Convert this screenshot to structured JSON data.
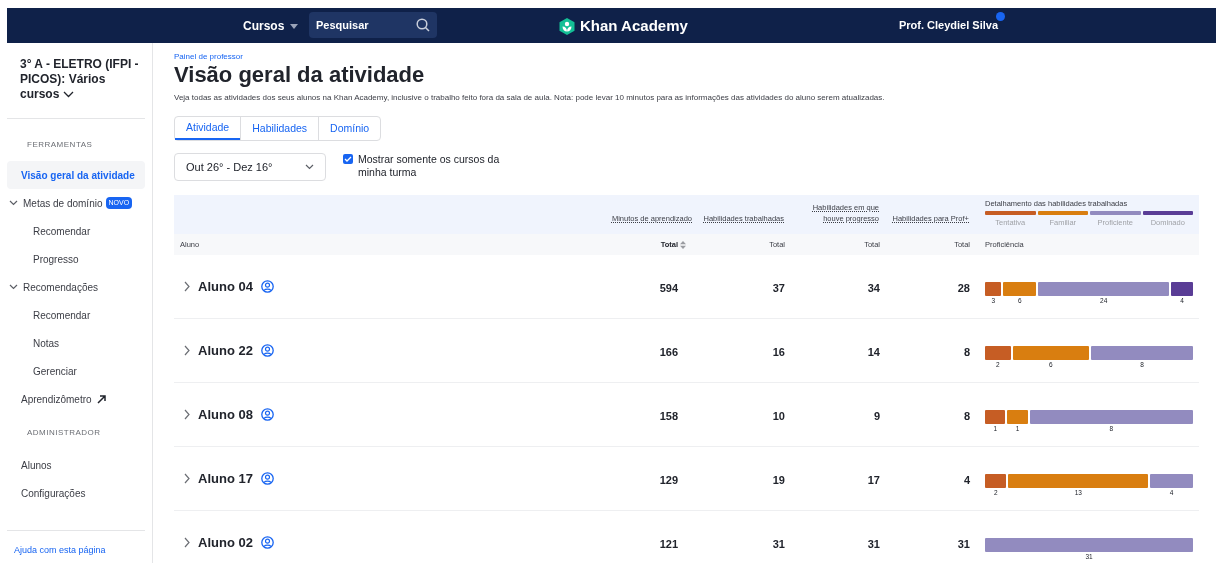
{
  "navbar": {
    "courses_menu": "Cursos",
    "search": {
      "placeholder": "Pesquisar"
    },
    "logo": "Khan Academy",
    "profile": {
      "name": "Prof. Cleydiel Silva",
      "notification": true
    }
  },
  "sidebar": {
    "class_title": "3° A - ELETRO (IFPI - PICOS): Vários cursos",
    "sections": [
      {
        "heading": "FERRAMENTAS",
        "items": [
          {
            "label": "Visão geral da atividade",
            "selected": true
          },
          {
            "label": "Metas de domínio",
            "badge": "NOVO",
            "expanded": true,
            "selected": false,
            "children": [
              {
                "label": "Recomendar",
                "selected": false
              },
              {
                "label": "Progresso",
                "selected": false
              }
            ]
          },
          {
            "label": "Recomendações",
            "expanded": true,
            "selected": false,
            "children": [
              {
                "label": "Recomendar",
                "selected": false
              },
              {
                "label": "Notas",
                "selected": false
              },
              {
                "label": "Gerenciar",
                "selected": false
              }
            ]
          },
          {
            "label": "Aprendizômetro",
            "external": true,
            "selected": false
          }
        ]
      },
      {
        "heading": "ADMINISTRADOR",
        "items": [
          {
            "label": "Alunos",
            "selected": false
          },
          {
            "label": "Configurações",
            "selected": false
          }
        ]
      }
    ],
    "help_link": "Ajuda com esta página"
  },
  "main": {
    "breadcrumb": "Painel de professor",
    "title": "Visão geral da atividade",
    "description": "Veja todas as atividades dos seus alunos na Khan Academy, inclusive o trabalho feito fora da sala de aula. Nota: pode levar 10 minutos para as informações das atividades do aluno serem atualizadas.",
    "tabs": [
      {
        "label": "Atividade",
        "selected": true
      },
      {
        "label": "Habilidades",
        "selected": false
      },
      {
        "label": "Domínio",
        "selected": false
      }
    ],
    "date_range": "Out 26° - Dez 16°",
    "filter_checkbox": {
      "label": "Mostrar somente os cursos da minha turma",
      "checked": true
    },
    "table": {
      "group_headers": [
        "Minutos de aprendizado",
        "Habilidades trabalhadas",
        "Habilidades em que houve progresso",
        "Habilidades para Prof+"
      ],
      "breakdown": {
        "title": "Detalhamento das habilidades trabalhadas",
        "legend": [
          {
            "kind": "tentativa",
            "label": "Tentativa"
          },
          {
            "kind": "familiar",
            "label": "Familiar"
          },
          {
            "kind": "proficiente",
            "label": "Proficiente"
          },
          {
            "kind": "dominado",
            "label": "Dominado"
          }
        ]
      },
      "columns": [
        "Aluno",
        "Total",
        "Total",
        "Total",
        "Total",
        "Proficiência"
      ],
      "rows": [
        {
          "student": "Aluno 04",
          "minutes": "594",
          "worked": "37",
          "progressed": "34",
          "prof_plus": "28",
          "segments": [
            {
              "kind": "tentativa",
              "count": "3"
            },
            {
              "kind": "familiar",
              "count": "6"
            },
            {
              "kind": "proficiente",
              "count": "24"
            },
            {
              "kind": "dominado",
              "count": "4"
            }
          ]
        },
        {
          "student": "Aluno 22",
          "minutes": "166",
          "worked": "16",
          "progressed": "14",
          "prof_plus": "8",
          "segments": [
            {
              "kind": "tentativa",
              "count": "2"
            },
            {
              "kind": "familiar",
              "count": "6"
            },
            {
              "kind": "proficiente",
              "count": "8"
            }
          ]
        },
        {
          "student": "Aluno 08",
          "minutes": "158",
          "worked": "10",
          "progressed": "9",
          "prof_plus": "8",
          "segments": [
            {
              "kind": "tentativa",
              "count": "1"
            },
            {
              "kind": "familiar",
              "count": "1"
            },
            {
              "kind": "proficiente",
              "count": "8"
            }
          ]
        },
        {
          "student": "Aluno 17",
          "minutes": "129",
          "worked": "19",
          "progressed": "17",
          "prof_plus": "4",
          "segments": [
            {
              "kind": "tentativa",
              "count": "2"
            },
            {
              "kind": "familiar",
              "count": "13"
            },
            {
              "kind": "proficiente",
              "count": "4"
            }
          ]
        },
        {
          "student": "Aluno 02",
          "minutes": "121",
          "worked": "31",
          "progressed": "31",
          "prof_plus": "31",
          "segments": [
            {
              "kind": "proficiente",
              "count": "31"
            }
          ]
        }
      ]
    }
  }
}
